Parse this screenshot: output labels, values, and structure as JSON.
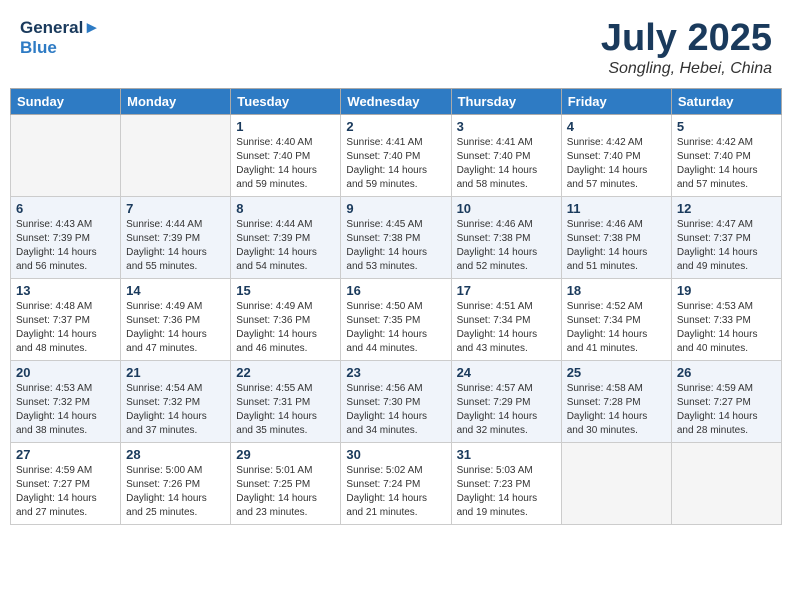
{
  "header": {
    "logo_line1": "General",
    "logo_line2": "Blue",
    "month": "July 2025",
    "location": "Songling, Hebei, China"
  },
  "weekdays": [
    "Sunday",
    "Monday",
    "Tuesday",
    "Wednesday",
    "Thursday",
    "Friday",
    "Saturday"
  ],
  "weeks": [
    [
      {
        "day": "",
        "info": ""
      },
      {
        "day": "",
        "info": ""
      },
      {
        "day": "1",
        "info": "Sunrise: 4:40 AM\nSunset: 7:40 PM\nDaylight: 14 hours and 59 minutes."
      },
      {
        "day": "2",
        "info": "Sunrise: 4:41 AM\nSunset: 7:40 PM\nDaylight: 14 hours and 59 minutes."
      },
      {
        "day": "3",
        "info": "Sunrise: 4:41 AM\nSunset: 7:40 PM\nDaylight: 14 hours and 58 minutes."
      },
      {
        "day": "4",
        "info": "Sunrise: 4:42 AM\nSunset: 7:40 PM\nDaylight: 14 hours and 57 minutes."
      },
      {
        "day": "5",
        "info": "Sunrise: 4:42 AM\nSunset: 7:40 PM\nDaylight: 14 hours and 57 minutes."
      }
    ],
    [
      {
        "day": "6",
        "info": "Sunrise: 4:43 AM\nSunset: 7:39 PM\nDaylight: 14 hours and 56 minutes."
      },
      {
        "day": "7",
        "info": "Sunrise: 4:44 AM\nSunset: 7:39 PM\nDaylight: 14 hours and 55 minutes."
      },
      {
        "day": "8",
        "info": "Sunrise: 4:44 AM\nSunset: 7:39 PM\nDaylight: 14 hours and 54 minutes."
      },
      {
        "day": "9",
        "info": "Sunrise: 4:45 AM\nSunset: 7:38 PM\nDaylight: 14 hours and 53 minutes."
      },
      {
        "day": "10",
        "info": "Sunrise: 4:46 AM\nSunset: 7:38 PM\nDaylight: 14 hours and 52 minutes."
      },
      {
        "day": "11",
        "info": "Sunrise: 4:46 AM\nSunset: 7:38 PM\nDaylight: 14 hours and 51 minutes."
      },
      {
        "day": "12",
        "info": "Sunrise: 4:47 AM\nSunset: 7:37 PM\nDaylight: 14 hours and 49 minutes."
      }
    ],
    [
      {
        "day": "13",
        "info": "Sunrise: 4:48 AM\nSunset: 7:37 PM\nDaylight: 14 hours and 48 minutes."
      },
      {
        "day": "14",
        "info": "Sunrise: 4:49 AM\nSunset: 7:36 PM\nDaylight: 14 hours and 47 minutes."
      },
      {
        "day": "15",
        "info": "Sunrise: 4:49 AM\nSunset: 7:36 PM\nDaylight: 14 hours and 46 minutes."
      },
      {
        "day": "16",
        "info": "Sunrise: 4:50 AM\nSunset: 7:35 PM\nDaylight: 14 hours and 44 minutes."
      },
      {
        "day": "17",
        "info": "Sunrise: 4:51 AM\nSunset: 7:34 PM\nDaylight: 14 hours and 43 minutes."
      },
      {
        "day": "18",
        "info": "Sunrise: 4:52 AM\nSunset: 7:34 PM\nDaylight: 14 hours and 41 minutes."
      },
      {
        "day": "19",
        "info": "Sunrise: 4:53 AM\nSunset: 7:33 PM\nDaylight: 14 hours and 40 minutes."
      }
    ],
    [
      {
        "day": "20",
        "info": "Sunrise: 4:53 AM\nSunset: 7:32 PM\nDaylight: 14 hours and 38 minutes."
      },
      {
        "day": "21",
        "info": "Sunrise: 4:54 AM\nSunset: 7:32 PM\nDaylight: 14 hours and 37 minutes."
      },
      {
        "day": "22",
        "info": "Sunrise: 4:55 AM\nSunset: 7:31 PM\nDaylight: 14 hours and 35 minutes."
      },
      {
        "day": "23",
        "info": "Sunrise: 4:56 AM\nSunset: 7:30 PM\nDaylight: 14 hours and 34 minutes."
      },
      {
        "day": "24",
        "info": "Sunrise: 4:57 AM\nSunset: 7:29 PM\nDaylight: 14 hours and 32 minutes."
      },
      {
        "day": "25",
        "info": "Sunrise: 4:58 AM\nSunset: 7:28 PM\nDaylight: 14 hours and 30 minutes."
      },
      {
        "day": "26",
        "info": "Sunrise: 4:59 AM\nSunset: 7:27 PM\nDaylight: 14 hours and 28 minutes."
      }
    ],
    [
      {
        "day": "27",
        "info": "Sunrise: 4:59 AM\nSunset: 7:27 PM\nDaylight: 14 hours and 27 minutes."
      },
      {
        "day": "28",
        "info": "Sunrise: 5:00 AM\nSunset: 7:26 PM\nDaylight: 14 hours and 25 minutes."
      },
      {
        "day": "29",
        "info": "Sunrise: 5:01 AM\nSunset: 7:25 PM\nDaylight: 14 hours and 23 minutes."
      },
      {
        "day": "30",
        "info": "Sunrise: 5:02 AM\nSunset: 7:24 PM\nDaylight: 14 hours and 21 minutes."
      },
      {
        "day": "31",
        "info": "Sunrise: 5:03 AM\nSunset: 7:23 PM\nDaylight: 14 hours and 19 minutes."
      },
      {
        "day": "",
        "info": ""
      },
      {
        "day": "",
        "info": ""
      }
    ]
  ]
}
